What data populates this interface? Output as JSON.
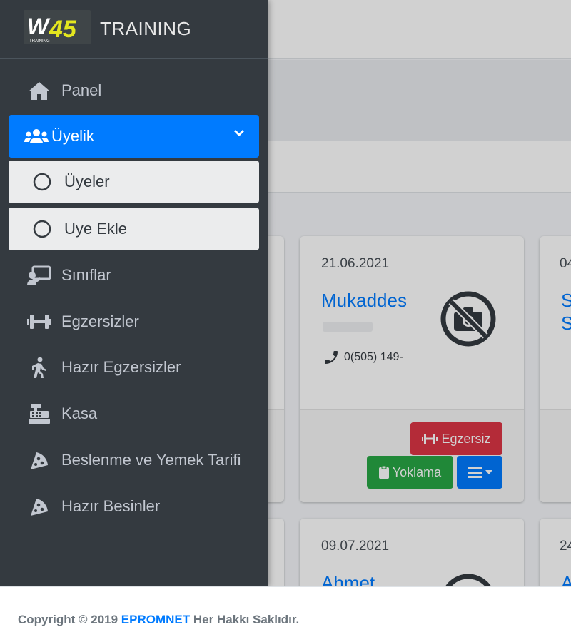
{
  "brand": {
    "logo_text": "W45",
    "logo_subtext": "TRAINING",
    "title": "TRAINING"
  },
  "sidebar": {
    "items": [
      {
        "label": "Panel",
        "icon": "home-icon"
      },
      {
        "label": "Üyelik",
        "icon": "users-icon",
        "active": true,
        "expanded": true
      },
      {
        "label": "Üyeler",
        "icon": "circle-icon",
        "sub": true
      },
      {
        "label": "Uye Ekle",
        "icon": "circle-icon",
        "sub": true
      },
      {
        "label": "Sınıflar",
        "icon": "chalkboard-teacher-icon"
      },
      {
        "label": "Egzersizler",
        "icon": "dumbbell-icon"
      },
      {
        "label": "Hazır Egzersizler",
        "icon": "walking-icon"
      },
      {
        "label": "Kasa",
        "icon": "cash-register-icon"
      },
      {
        "label": "Beslenme ve Yemek Tarifi",
        "icon": "pizza-slice-icon"
      },
      {
        "label": "Hazır Besinler",
        "icon": "pizza-slice-icon"
      }
    ]
  },
  "cards": [
    {
      "date": "21.06.2021",
      "name": "Mukaddes",
      "phone": "0(505) 149-",
      "buttons": {
        "egzersiz": "Egzersiz",
        "yoklama": "Yoklama"
      }
    },
    {
      "date": "04",
      "name_lines": [
        "S",
        "S"
      ]
    },
    {
      "date": "09.07.2021",
      "name": "Ahmet"
    },
    {
      "date": "24",
      "name": "A"
    }
  ],
  "footer": {
    "prefix": "Copyright © 2019 ",
    "link": "EPROMNET",
    "suffix": " Her Hakkı Saklıdır."
  },
  "colors": {
    "sidebar_bg": "#343a40",
    "active": "#007bff",
    "danger": "#dc3545",
    "success": "#28a745"
  }
}
